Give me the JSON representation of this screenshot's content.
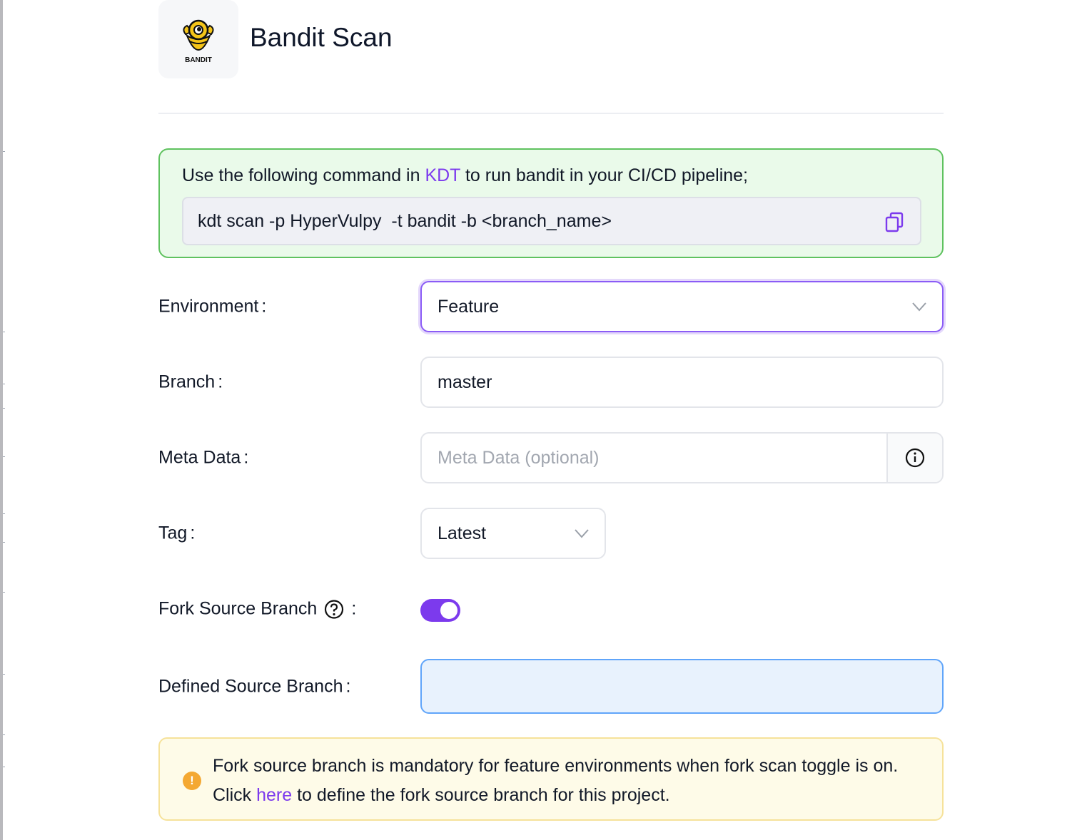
{
  "header": {
    "title": "Bandit Scan",
    "logo_text": "BANDIT",
    "logo_icon": "bandit-logo-icon"
  },
  "command": {
    "intro_before": "Use the following command in ",
    "intro_link": "KDT",
    "intro_after": " to run bandit in your CI/CD pipeline;",
    "code": "kdt scan -p HyperVulpy  -t bandit -b <branch_name>",
    "copy_icon": "copy-icon"
  },
  "form": {
    "environment": {
      "label": "Environment",
      "value": "Feature"
    },
    "branch": {
      "label": "Branch",
      "value": "master"
    },
    "meta_data": {
      "label": "Meta Data",
      "placeholder": "Meta Data (optional)",
      "addon_icon": "info-icon"
    },
    "tag": {
      "label": "Tag",
      "value": "Latest"
    },
    "fork_source_branch": {
      "label": "Fork Source Branch",
      "help_icon": "question-circle-icon",
      "enabled": true
    },
    "defined_source_branch": {
      "label": "Defined Source Branch",
      "value": ""
    },
    "colon": ":"
  },
  "warning": {
    "icon": "warning-icon",
    "icon_glyph": "!",
    "text_before": "Fork source branch is mandatory for feature environments when fork scan toggle is on. Click ",
    "link": "here",
    "text_after": " to define the fork source branch for this project."
  },
  "colors": {
    "accent": "#7c3aed",
    "command_border": "#5fc25f",
    "command_bg": "#eafaea",
    "warning_bg": "#fefbe8",
    "warning_icon": "#f4a832",
    "focus_border": "#60a5fa"
  }
}
